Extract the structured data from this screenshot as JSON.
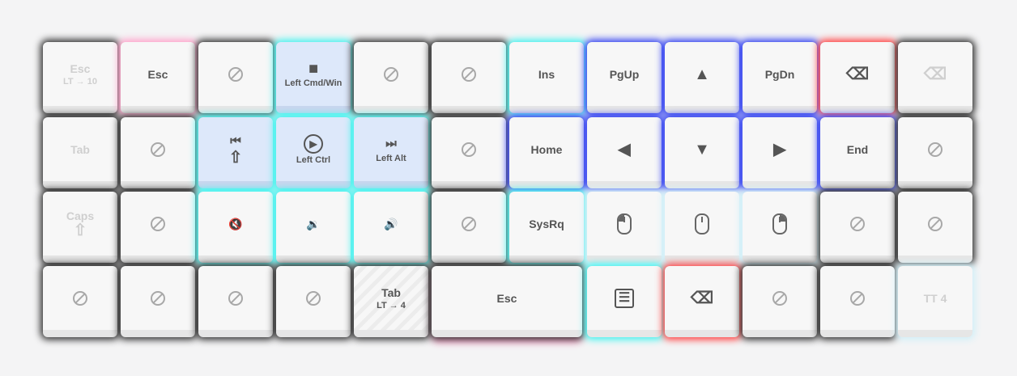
{
  "keys": {
    "r0": [
      "Esc",
      "Esc",
      "Left Cmd/Win",
      "Ins",
      "PgUp",
      "PgDn"
    ],
    "r0_sub": [
      "LT → 10"
    ],
    "r1": [
      "Tab",
      "Left Ctrl",
      "Left Alt",
      "Home",
      "End"
    ],
    "r2": [
      "Caps",
      "SysRq"
    ],
    "r3": [
      "Tab",
      "Esc",
      "TT 4"
    ],
    "r3_sub": [
      "LT → 4"
    ]
  },
  "glyphs": {
    "stop": "■",
    "up": "▲",
    "left": "◀",
    "down": "▼",
    "right": "▶",
    "prev": "⏮",
    "play": "▶",
    "next": "⏭",
    "shift": "⇧",
    "mute": "🔇",
    "vol_down": "🔉",
    "vol_up": "🔊",
    "backspace": "⌫",
    "menu": "☰"
  },
  "icons": [
    "no-op-icon",
    "backspace-icon",
    "mouse-button-icon",
    "menu-icon",
    "shift-icon",
    "media-prev-icon",
    "media-play-icon",
    "media-next-icon",
    "mute-icon",
    "volume-down-icon",
    "volume-up-icon",
    "arrow-icon",
    "stop-icon"
  ],
  "glows": {
    "pink": "#ff9ec8",
    "cyan": "#3ef2ee",
    "blue": "#2a3af0",
    "red": "#ff3b3b",
    "dark": "#2b2b2b",
    "ice": "#cfeff8"
  }
}
